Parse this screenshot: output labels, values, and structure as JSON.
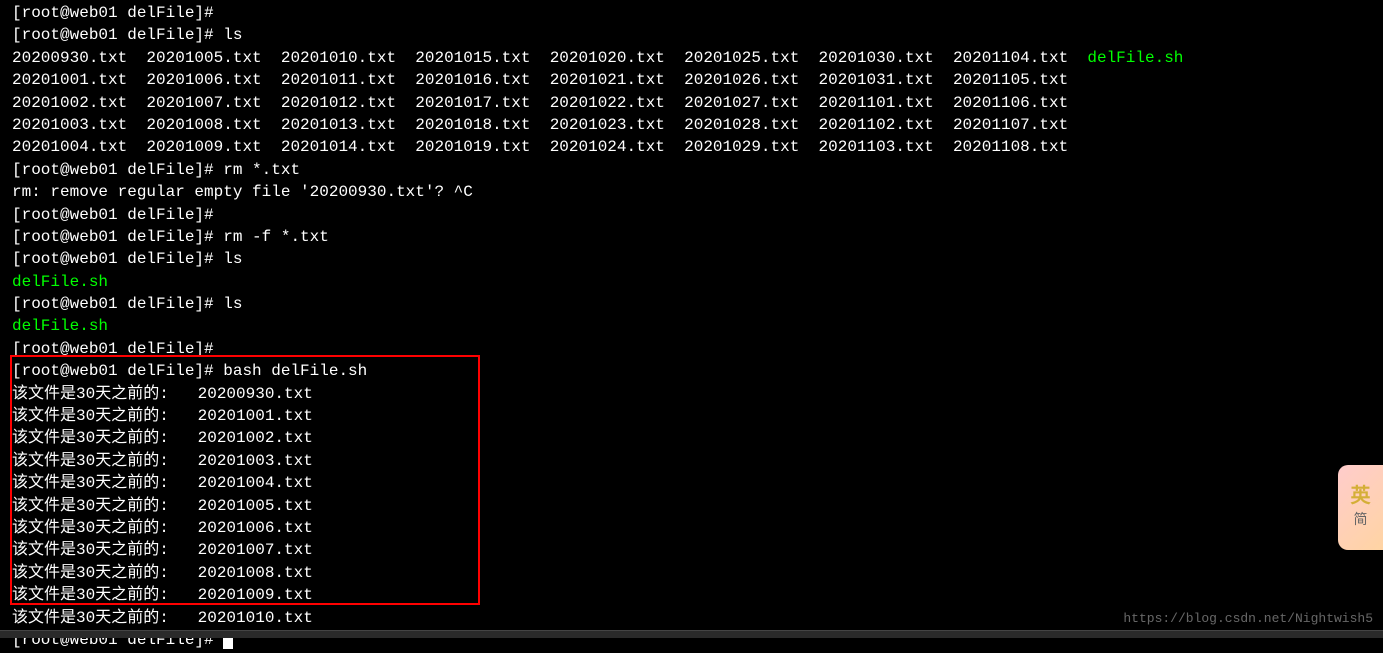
{
  "prompt": {
    "user": "root",
    "host": "web01",
    "dir": "delFile",
    "symbol": "#"
  },
  "lines": [
    {
      "type": "prompt_partial",
      "text": "[root@web01 delFile]#"
    },
    {
      "type": "prompt_cmd",
      "cmd": "ls"
    },
    {
      "type": "ls_row",
      "text": "20200930.txt  20201005.txt  20201010.txt  20201015.txt  20201020.txt  20201025.txt  20201030.txt  20201104.txt  ",
      "green": "delFile.sh"
    },
    {
      "type": "ls_row",
      "text": "20201001.txt  20201006.txt  20201011.txt  20201016.txt  20201021.txt  20201026.txt  20201031.txt  20201105.txt"
    },
    {
      "type": "ls_row",
      "text": "20201002.txt  20201007.txt  20201012.txt  20201017.txt  20201022.txt  20201027.txt  20201101.txt  20201106.txt"
    },
    {
      "type": "ls_row",
      "text": "20201003.txt  20201008.txt  20201013.txt  20201018.txt  20201023.txt  20201028.txt  20201102.txt  20201107.txt"
    },
    {
      "type": "ls_row",
      "text": "20201004.txt  20201009.txt  20201014.txt  20201019.txt  20201024.txt  20201029.txt  20201103.txt  20201108.txt"
    },
    {
      "type": "prompt_cmd",
      "cmd": "rm *.txt"
    },
    {
      "type": "output",
      "text": "rm: remove regular empty file '20200930.txt'? ^C"
    },
    {
      "type": "prompt_cmd",
      "cmd": ""
    },
    {
      "type": "prompt_cmd",
      "cmd": "rm -f *.txt"
    },
    {
      "type": "prompt_cmd",
      "cmd": "ls"
    },
    {
      "type": "green_output",
      "text": "delFile.sh"
    },
    {
      "type": "prompt_cmd",
      "cmd": "ls"
    },
    {
      "type": "green_output",
      "text": "delFile.sh"
    },
    {
      "type": "prompt_cmd",
      "cmd": ""
    },
    {
      "type": "prompt_cmd",
      "cmd": "bash delFile.sh"
    },
    {
      "type": "output",
      "text": "该文件是30天之前的:   20200930.txt"
    },
    {
      "type": "output",
      "text": "该文件是30天之前的:   20201001.txt"
    },
    {
      "type": "output",
      "text": "该文件是30天之前的:   20201002.txt"
    },
    {
      "type": "output",
      "text": "该文件是30天之前的:   20201003.txt"
    },
    {
      "type": "output",
      "text": "该文件是30天之前的:   20201004.txt"
    },
    {
      "type": "output",
      "text": "该文件是30天之前的:   20201005.txt"
    },
    {
      "type": "output",
      "text": "该文件是30天之前的:   20201006.txt"
    },
    {
      "type": "output",
      "text": "该文件是30天之前的:   20201007.txt"
    },
    {
      "type": "output",
      "text": "该文件是30天之前的:   20201008.txt"
    },
    {
      "type": "output",
      "text": "该文件是30天之前的:   20201009.txt"
    },
    {
      "type": "output",
      "text": "该文件是30天之前的:   20201010.txt"
    },
    {
      "type": "prompt_cursor",
      "cmd": ""
    }
  ],
  "widget": {
    "char1": "英",
    "char2": "简"
  },
  "watermark": "https://blog.csdn.net/Nightwish5"
}
